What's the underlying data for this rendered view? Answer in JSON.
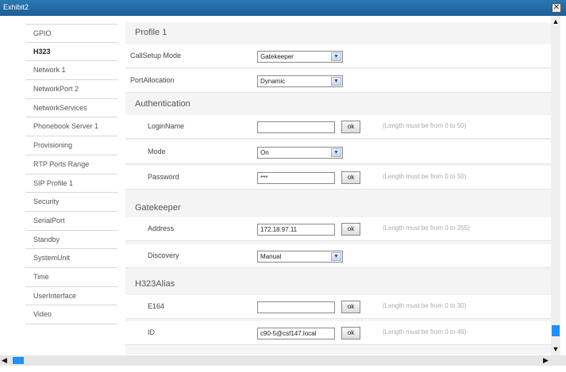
{
  "window": {
    "title": "Exhibit2",
    "close_glyph": "✕"
  },
  "sidebar": {
    "items": [
      {
        "label": "GPIO"
      },
      {
        "label": "H323"
      },
      {
        "label": "Network 1"
      },
      {
        "label": "NetworkPort 2"
      },
      {
        "label": "NetworkServices"
      },
      {
        "label": "Phonebook Server 1"
      },
      {
        "label": "Provisioning"
      },
      {
        "label": "RTP Ports Range"
      },
      {
        "label": "SIP Profile 1"
      },
      {
        "label": "Security"
      },
      {
        "label": "SerialPort"
      },
      {
        "label": "Standby"
      },
      {
        "label": "SystemUnit"
      },
      {
        "label": "Time"
      },
      {
        "label": "UserInterface"
      },
      {
        "label": "Video"
      }
    ],
    "active": "H323"
  },
  "content": {
    "profile": {
      "title": "Profile 1",
      "callsetup_label": "CallSetup Mode",
      "callsetup_value": "Gatekeeper",
      "portalloc_label": "PortAllocation",
      "portalloc_value": "Dynamic"
    },
    "authentication": {
      "title": "Authentication",
      "login_label": "LoginName",
      "login_value": "",
      "login_ok": "ok",
      "login_hint": "(Length must be from 0 to 50)",
      "mode_label": "Mode",
      "mode_value": "On",
      "password_label": "Password",
      "password_value": "***",
      "password_ok": "ok",
      "password_hint": "(Length must be from 0 to 50)"
    },
    "gatekeeper": {
      "title": "Gatekeeper",
      "address_label": "Address",
      "address_value": "172.18.97.11",
      "address_ok": "ok",
      "address_hint": "(Length must be from 0 to 255)",
      "discovery_label": "Discovery",
      "discovery_value": "Manual"
    },
    "alias": {
      "title": "H323Alias",
      "e164_label": "E164",
      "e164_value": "",
      "e164_ok": "ok",
      "e164_hint": "(Length must be from 0 to 30)",
      "id_label": "ID",
      "id_value": "c90-5@csf147.local",
      "id_ok": "ok",
      "id_hint": "(Length must be from 0 to 49)"
    }
  },
  "icons": {
    "dropdown": "chevron-down-icon",
    "scroll_up": "▲",
    "scroll_down": "▼",
    "scroll_left": "◀",
    "scroll_right": "▶"
  },
  "colors": {
    "titlebar": "#1c5f99",
    "scroll_thumb": "#1e90ff"
  }
}
